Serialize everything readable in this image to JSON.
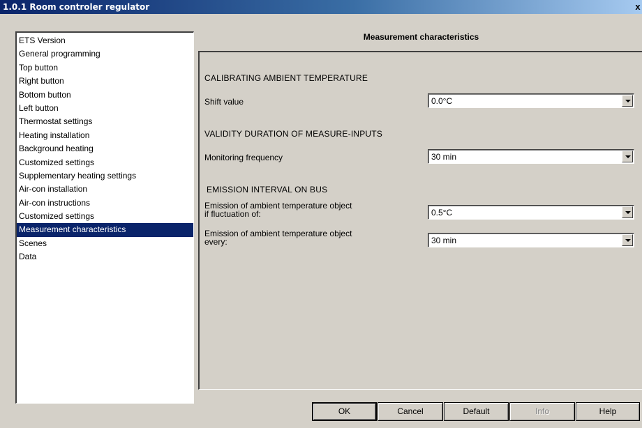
{
  "window": {
    "title": "1.0.1 Room controler regulator",
    "close_label": "x"
  },
  "sidebar": {
    "items": [
      {
        "label": "ETS Version"
      },
      {
        "label": "General programming"
      },
      {
        "label": "Top button"
      },
      {
        "label": "Right button"
      },
      {
        "label": "Bottom button"
      },
      {
        "label": "Left button"
      },
      {
        "label": "Thermostat settings"
      },
      {
        "label": "Heating installation"
      },
      {
        "label": "Background heating"
      },
      {
        "label": "Customized settings"
      },
      {
        "label": "Supplementary heating settings"
      },
      {
        "label": "Air-con installation"
      },
      {
        "label": "Air-con instructions"
      },
      {
        "label": "Customized settings"
      },
      {
        "label": "Measurement characteristics"
      },
      {
        "label": "Scenes"
      },
      {
        "label": "Data"
      }
    ],
    "selected_index": 14,
    "selected_color": "#0a246a"
  },
  "panel": {
    "title": "Measurement characteristics",
    "sections": [
      {
        "heading": "CALIBRATING AMBIENT TEMPERATURE"
      },
      {
        "heading": "VALIDITY DURATION OF MEASURE-INPUTS"
      },
      {
        "heading": "EMISSION INTERVAL ON BUS"
      }
    ],
    "params": [
      {
        "label": "Shift value",
        "value": "0.0°C"
      },
      {
        "label": "Monitoring frequency",
        "value": "30 min"
      },
      {
        "label_line1": "Emission of ambient temperature object",
        "label_line2": "if fluctuation of:",
        "value": "0.5°C"
      },
      {
        "label_line1": "Emission of ambient temperature object",
        "label_line2": "every:",
        "value": "30 min"
      }
    ]
  },
  "buttons": {
    "ok": "OK",
    "cancel": "Cancel",
    "default": "Default",
    "info": "Info",
    "help": "Help"
  }
}
